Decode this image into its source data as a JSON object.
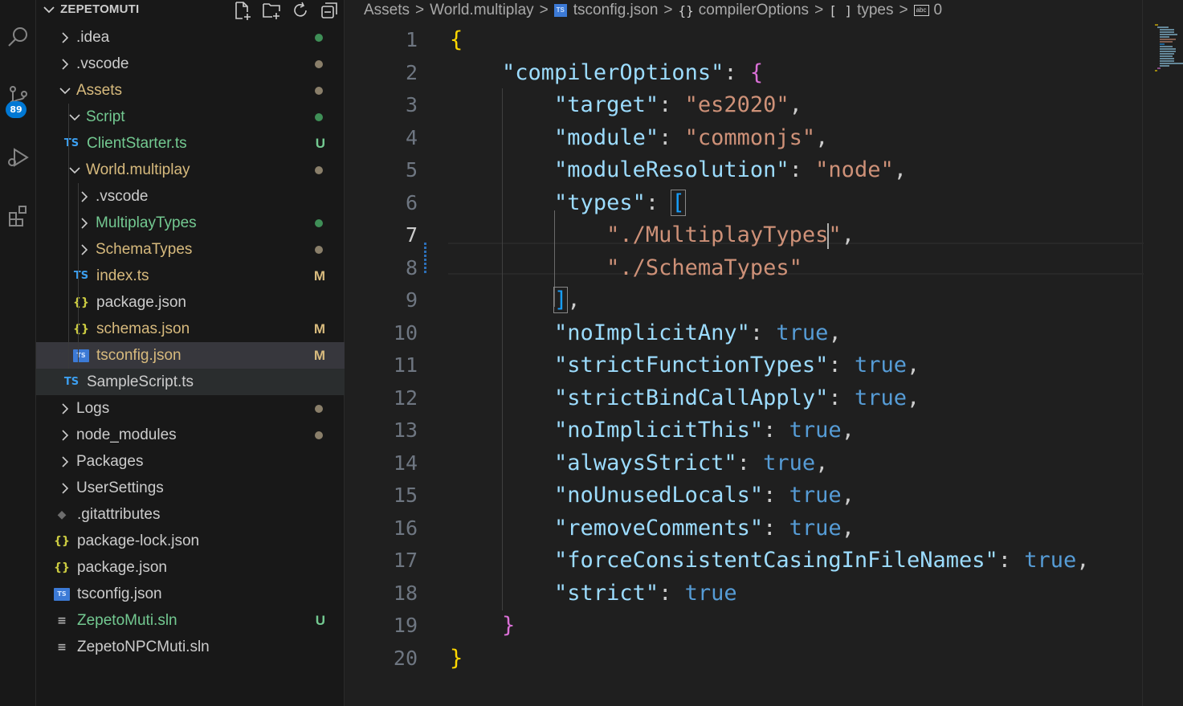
{
  "explorer": {
    "title": "ZEPETOMUTI",
    "actions": [
      "new-file-icon",
      "new-folder-icon",
      "refresh-icon",
      "collapse-all-icon"
    ]
  },
  "activity": {
    "scm_badge": "89"
  },
  "tree": [
    {
      "label": ".idea",
      "kind": "folder",
      "open": false,
      "depth": 1,
      "status": "dot",
      "status_color": "#3f8f57"
    },
    {
      "label": ".vscode",
      "kind": "folder",
      "open": false,
      "depth": 1,
      "status": "dot",
      "status_color": "#8a7f6a"
    },
    {
      "label": "Assets",
      "kind": "folder",
      "open": true,
      "depth": 1,
      "status": "dot",
      "status_color": "#8a7f6a",
      "color": "#d7ba7d"
    },
    {
      "label": "Script",
      "kind": "folder",
      "open": true,
      "depth": 2,
      "status": "dot",
      "status_color": "#3f8f57",
      "color": "#73c991"
    },
    {
      "label": "ClientStarter.ts",
      "kind": "ts",
      "depth": 3,
      "status": "U",
      "status_color": "#73c991",
      "color": "#73c991"
    },
    {
      "label": "World.multiplay",
      "kind": "folder",
      "open": true,
      "depth": 2,
      "status": "dot",
      "status_color": "#8a7f6a",
      "color": "#d7ba7d"
    },
    {
      "label": ".vscode",
      "kind": "folder",
      "open": false,
      "depth": 3
    },
    {
      "label": "MultiplayTypes",
      "kind": "folder",
      "open": false,
      "depth": 3,
      "status": "dot",
      "status_color": "#3f8f57",
      "color": "#73c991"
    },
    {
      "label": "SchemaTypes",
      "kind": "folder",
      "open": false,
      "depth": 3,
      "status": "dot",
      "status_color": "#8a7f6a",
      "color": "#d7ba7d"
    },
    {
      "label": "index.ts",
      "kind": "ts",
      "depth": 4,
      "status": "M",
      "status_color": "#d7ba7d",
      "color": "#d7ba7d"
    },
    {
      "label": "package.json",
      "kind": "json",
      "depth": 4
    },
    {
      "label": "schemas.json",
      "kind": "json",
      "depth": 4,
      "status": "M",
      "status_color": "#d7ba7d",
      "color": "#d7ba7d"
    },
    {
      "label": "tsconfig.json",
      "kind": "tsconfig",
      "depth": 4,
      "status": "M",
      "status_color": "#d7ba7d",
      "color": "#d7ba7d",
      "selected": true
    },
    {
      "label": "SampleScript.ts",
      "kind": "ts",
      "depth": 3,
      "hover": true
    },
    {
      "label": "Logs",
      "kind": "folder",
      "open": false,
      "depth": 1,
      "status": "dot",
      "status_color": "#8a7f6a"
    },
    {
      "label": "node_modules",
      "kind": "folder",
      "open": false,
      "depth": 1,
      "status": "dot",
      "status_color": "#8a7f6a"
    },
    {
      "label": "Packages",
      "kind": "folder",
      "open": false,
      "depth": 1
    },
    {
      "label": "UserSettings",
      "kind": "folder",
      "open": false,
      "depth": 1
    },
    {
      "label": ".gitattributes",
      "kind": "git",
      "depth": 2
    },
    {
      "label": "package-lock.json",
      "kind": "json",
      "depth": 2
    },
    {
      "label": "package.json",
      "kind": "json",
      "depth": 2
    },
    {
      "label": "tsconfig.json",
      "kind": "tsconfig",
      "depth": 2
    },
    {
      "label": "ZepetoMuti.sln",
      "kind": "sln",
      "depth": 2,
      "status": "U",
      "status_color": "#73c991",
      "color": "#73c991"
    },
    {
      "label": "ZepetoNPCMuti.sln",
      "kind": "sln",
      "depth": 2
    }
  ],
  "breadcrumb": {
    "items": [
      "Assets",
      "World.multiplay",
      "tsconfig.json",
      "compilerOptions",
      "types",
      "0"
    ],
    "icons": [
      "",
      "",
      "ts-file-icon",
      "object-icon",
      "array-icon",
      "string-icon"
    ]
  },
  "editor": {
    "active_line": 7,
    "lines": [
      {
        "n": "1",
        "tokens": [
          {
            "t": "{",
            "c": "br1"
          }
        ]
      },
      {
        "n": "2",
        "tokens": [
          {
            "t": "    "
          },
          {
            "t": "\"compilerOptions\"",
            "c": "k"
          },
          {
            "t": ": ",
            "c": "p"
          },
          {
            "t": "{",
            "c": "br2"
          }
        ]
      },
      {
        "n": "3",
        "tokens": [
          {
            "t": "        "
          },
          {
            "t": "\"target\"",
            "c": "k"
          },
          {
            "t": ": ",
            "c": "p"
          },
          {
            "t": "\"es2020\"",
            "c": "s"
          },
          {
            "t": ",",
            "c": "p"
          }
        ]
      },
      {
        "n": "4",
        "tokens": [
          {
            "t": "        "
          },
          {
            "t": "\"module\"",
            "c": "k"
          },
          {
            "t": ": ",
            "c": "p"
          },
          {
            "t": "\"commonjs\"",
            "c": "s"
          },
          {
            "t": ",",
            "c": "p"
          }
        ]
      },
      {
        "n": "5",
        "tokens": [
          {
            "t": "        "
          },
          {
            "t": "\"moduleResolution\"",
            "c": "k"
          },
          {
            "t": ": ",
            "c": "p"
          },
          {
            "t": "\"node\"",
            "c": "s"
          },
          {
            "t": ",",
            "c": "p"
          }
        ]
      },
      {
        "n": "6",
        "tokens": [
          {
            "t": "        "
          },
          {
            "t": "\"types\"",
            "c": "k"
          },
          {
            "t": ": ",
            "c": "p"
          },
          {
            "t": "[",
            "c": "br3 brhl"
          }
        ]
      },
      {
        "n": "7",
        "tokens": [
          {
            "t": "            "
          },
          {
            "t": "\"./MultiplayTypes",
            "c": "s"
          },
          {
            "t": "|CURSOR|"
          },
          {
            "t": "\"",
            "c": "s"
          },
          {
            "t": ",",
            "c": "p"
          }
        ]
      },
      {
        "n": "8",
        "tokens": [
          {
            "t": "            "
          },
          {
            "t": "\"./SchemaTypes\"",
            "c": "s"
          }
        ]
      },
      {
        "n": "9",
        "tokens": [
          {
            "t": "        "
          },
          {
            "t": "]",
            "c": "br3 brhl"
          },
          {
            "t": ",",
            "c": "p"
          }
        ]
      },
      {
        "n": "10",
        "tokens": [
          {
            "t": "        "
          },
          {
            "t": "\"noImplicitAny\"",
            "c": "k"
          },
          {
            "t": ": ",
            "c": "p"
          },
          {
            "t": "true",
            "c": "b"
          },
          {
            "t": ",",
            "c": "p"
          }
        ]
      },
      {
        "n": "11",
        "tokens": [
          {
            "t": "        "
          },
          {
            "t": "\"strictFunctionTypes\"",
            "c": "k"
          },
          {
            "t": ": ",
            "c": "p"
          },
          {
            "t": "true",
            "c": "b"
          },
          {
            "t": ",",
            "c": "p"
          }
        ]
      },
      {
        "n": "12",
        "tokens": [
          {
            "t": "        "
          },
          {
            "t": "\"strictBindCallApply\"",
            "c": "k"
          },
          {
            "t": ": ",
            "c": "p"
          },
          {
            "t": "true",
            "c": "b"
          },
          {
            "t": ",",
            "c": "p"
          }
        ]
      },
      {
        "n": "13",
        "tokens": [
          {
            "t": "        "
          },
          {
            "t": "\"noImplicitThis\"",
            "c": "k"
          },
          {
            "t": ": ",
            "c": "p"
          },
          {
            "t": "true",
            "c": "b"
          },
          {
            "t": ",",
            "c": "p"
          }
        ]
      },
      {
        "n": "14",
        "tokens": [
          {
            "t": "        "
          },
          {
            "t": "\"alwaysStrict\"",
            "c": "k"
          },
          {
            "t": ": ",
            "c": "p"
          },
          {
            "t": "true",
            "c": "b"
          },
          {
            "t": ",",
            "c": "p"
          }
        ]
      },
      {
        "n": "15",
        "tokens": [
          {
            "t": "        "
          },
          {
            "t": "\"noUnusedLocals\"",
            "c": "k"
          },
          {
            "t": ": ",
            "c": "p"
          },
          {
            "t": "true",
            "c": "b"
          },
          {
            "t": ",",
            "c": "p"
          }
        ]
      },
      {
        "n": "16",
        "tokens": [
          {
            "t": "        "
          },
          {
            "t": "\"removeComments\"",
            "c": "k"
          },
          {
            "t": ": ",
            "c": "p"
          },
          {
            "t": "true",
            "c": "b"
          },
          {
            "t": ",",
            "c": "p"
          }
        ]
      },
      {
        "n": "17",
        "tokens": [
          {
            "t": "        "
          },
          {
            "t": "\"forceConsistentCasingInFileNames\"",
            "c": "k"
          },
          {
            "t": ": ",
            "c": "p"
          },
          {
            "t": "true",
            "c": "b"
          },
          {
            "t": ",",
            "c": "p"
          }
        ]
      },
      {
        "n": "18",
        "tokens": [
          {
            "t": "        "
          },
          {
            "t": "\"strict\"",
            "c": "k"
          },
          {
            "t": ": ",
            "c": "p"
          },
          {
            "t": "true",
            "c": "b"
          }
        ]
      },
      {
        "n": "19",
        "tokens": [
          {
            "t": "    "
          },
          {
            "t": "}",
            "c": "br2"
          }
        ]
      },
      {
        "n": "20",
        "tokens": [
          {
            "t": "}",
            "c": "br1"
          }
        ]
      }
    ]
  }
}
